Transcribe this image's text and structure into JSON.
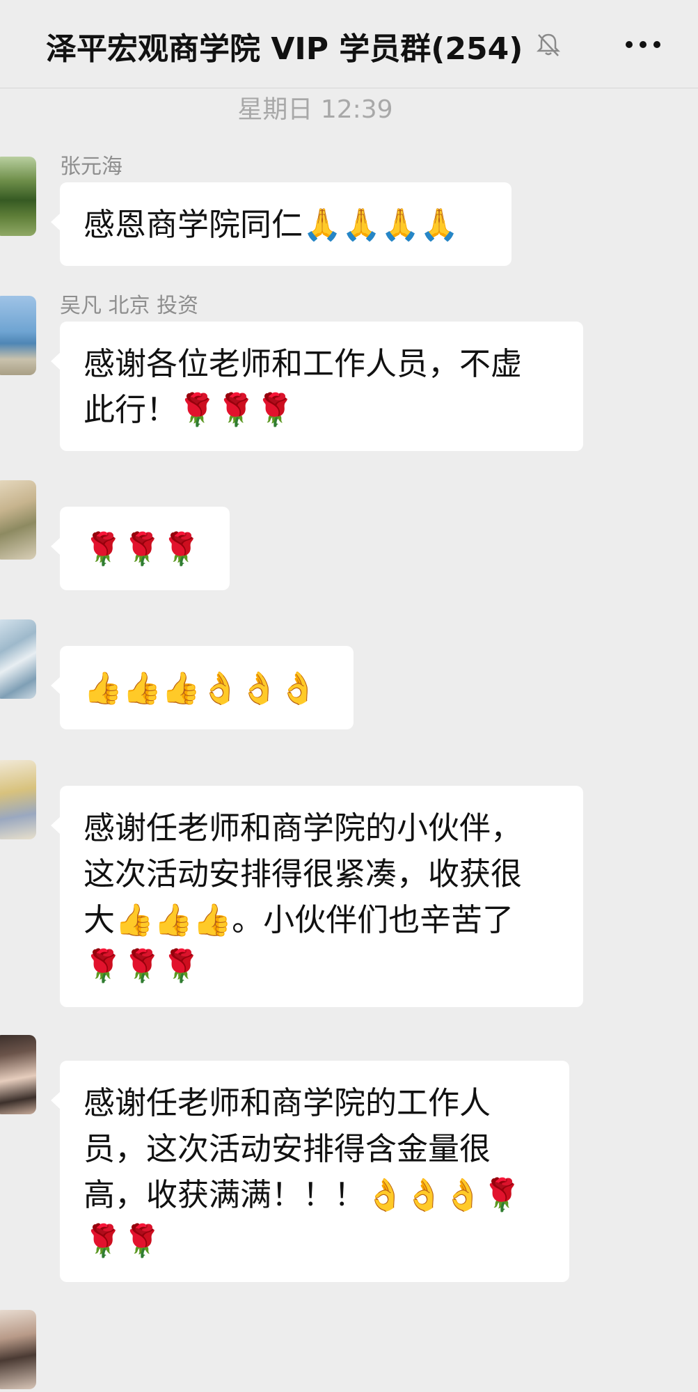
{
  "header": {
    "title": "泽平宏观商学院 VIP 学员群(254)",
    "mute_icon": "bell-slash-icon",
    "more_icon": "more-dots-icon"
  },
  "timestamp": "星期日 12:39",
  "messages": [
    {
      "sender": "张元海",
      "text": "感恩商学院同仁🙏🙏🙏🙏"
    },
    {
      "sender": "吴凡 北京 投资",
      "text": "感谢各位老师和工作人员，不虚\n此行！🌹🌹🌹"
    },
    {
      "sender": "",
      "text": "🌹🌹🌹"
    },
    {
      "sender": "",
      "text": "👍👍👍👌👌👌"
    },
    {
      "sender": "",
      "text": "感谢任老师和商学院的小伙伴，\n这次活动安排得很紧凑，收获很\n大👍👍👍。小伙伴们也辛苦了\n🌹🌹🌹"
    },
    {
      "sender": "",
      "text": "感谢任老师和商学院的工作人\n员，这次活动安排得含金量很\n高，收获满满！！！👌👌👌🌹\n🌹🌹"
    }
  ]
}
